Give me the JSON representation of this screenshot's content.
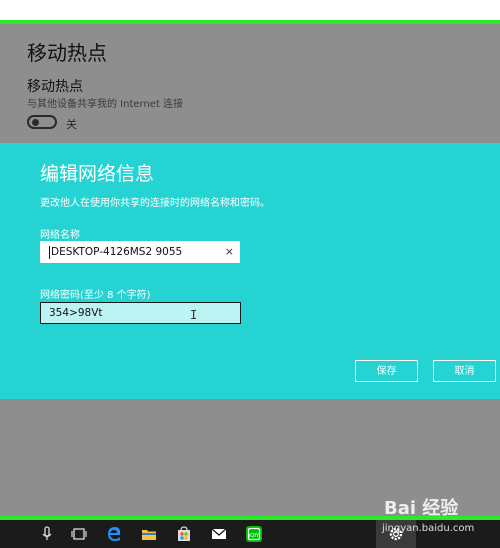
{
  "settings": {
    "title": "移动热点",
    "hotspot_label": "移动热点",
    "hotspot_desc": "与其他设备共享我的 Internet 连接",
    "toggle_state": "关"
  },
  "dialog": {
    "title": "编辑网络信息",
    "description": "更改他人在使用你共享的连接时的网络名称和密码。",
    "network_name_label": "网络名称",
    "network_name_value": "DESKTOP-4126MS2 9055",
    "clear_symbol": "×",
    "password_label": "网络密码(至少 8 个字符)",
    "password_value": "354>98Vt",
    "save_label": "保存",
    "cancel_label": "取消"
  },
  "taskbar": {
    "icons": [
      "microphone-icon",
      "task-view-icon",
      "edge-icon",
      "file-explorer-icon",
      "store-icon",
      "mail-icon",
      "iqiyi-icon",
      "settings-icon"
    ]
  },
  "watermark": {
    "text": "Bai 经验",
    "sub": "jingyan.baidu.com"
  },
  "colors": {
    "dialog_bg": "#26d3d3",
    "settings_bg": "#8e8e8e",
    "accent_green": "#2ee82e",
    "taskbar_bg": "#1b1b1b"
  }
}
